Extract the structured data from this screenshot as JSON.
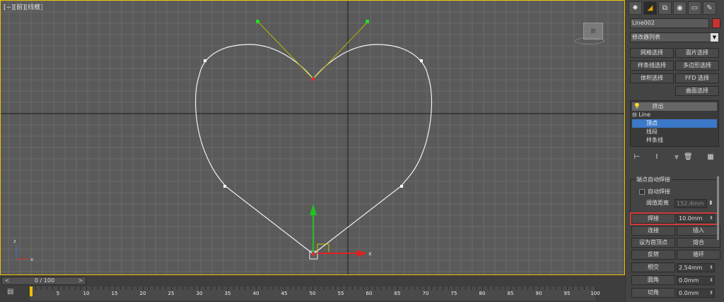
{
  "viewport": {
    "label": "[+][前][线框]",
    "cube_label": "前",
    "axis_x": "x",
    "axis_y": "y",
    "axis_z": "z"
  },
  "timeline": {
    "frame": "0 / 100",
    "prev": "<",
    "next": ">",
    "ticks": [
      "5",
      "10",
      "15",
      "20",
      "25",
      "30",
      "35",
      "40",
      "45",
      "50",
      "55",
      "60",
      "65",
      "70",
      "75",
      "80",
      "85",
      "90",
      "95",
      "100"
    ]
  },
  "panel": {
    "tabs": [
      "create",
      "modify",
      "hierarchy",
      "motion",
      "display",
      "utilities"
    ],
    "object_name": "Line002",
    "object_color": "#c8332e",
    "modifier_list": "修改器列表",
    "mod_buttons": [
      "网格选择",
      "面片选择",
      "样条线选择",
      "多边形选择",
      "体积选择",
      "FFD 选择",
      "曲面选择"
    ],
    "stack": {
      "top": "挤出",
      "base": "Line",
      "sub": [
        "顶点",
        "线段",
        "样条线"
      ]
    },
    "rollout_title": "端点自动焊接",
    "auto_weld": "自动焊接",
    "threshold_label": "阈值距离",
    "threshold_value": "152.4mm",
    "weld": "焊接",
    "weld_value": "10.0mm",
    "connect": "连接",
    "insert": "插入",
    "make_first": "设为首顶点",
    "fuse": "熔合",
    "reverse": "反转",
    "cycle": "循环",
    "intersect": "相交",
    "intersect_value": "2.54mm",
    "fillet": "圆角",
    "fillet_value": "0.0mm",
    "chamfer": "切角",
    "chamfer_value": "0.0mm"
  }
}
